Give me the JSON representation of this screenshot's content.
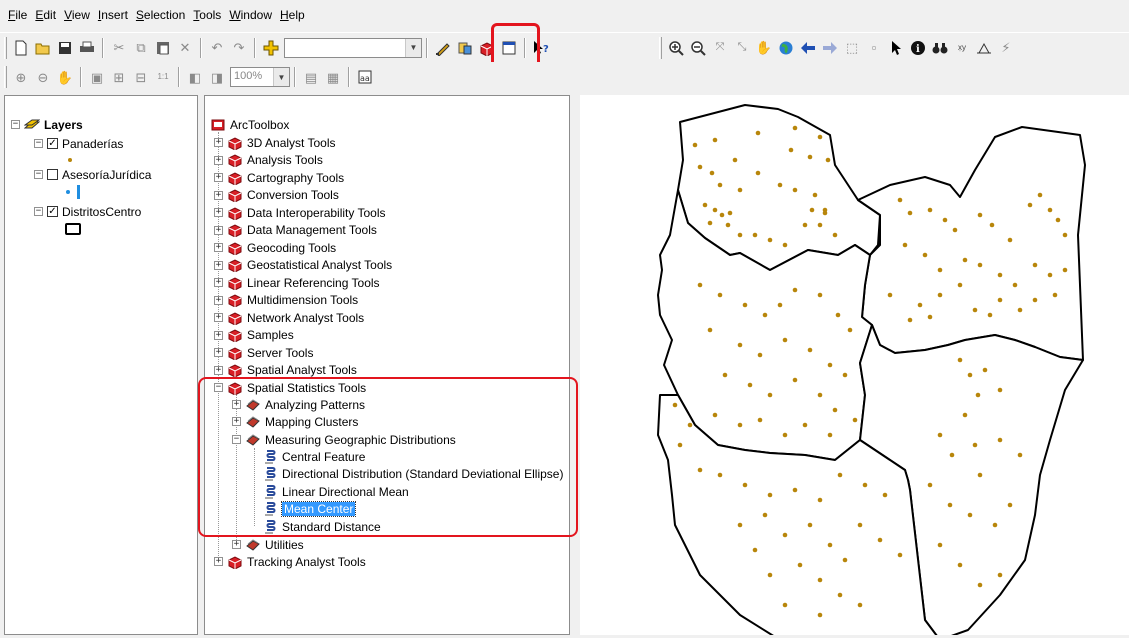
{
  "menu": [
    {
      "u": "F",
      "rest": "ile"
    },
    {
      "u": "E",
      "rest": "dit"
    },
    {
      "u": "V",
      "rest": "iew"
    },
    {
      "u": "I",
      "rest": "nsert"
    },
    {
      "u": "S",
      "rest": "election"
    },
    {
      "u": "T",
      "rest": "ools"
    },
    {
      "u": "W",
      "rest": "indow"
    },
    {
      "u": "H",
      "rest": "elp"
    }
  ],
  "toolbar": {
    "scale_value": "",
    "zoom_value": "100%"
  },
  "toc": {
    "title": "Layers",
    "layers": [
      {
        "name": "Panaderías",
        "checked": true
      },
      {
        "name": "AsesoríaJurídica",
        "checked": false
      },
      {
        "name": "DistritosCentro",
        "checked": true
      }
    ]
  },
  "toolbox": {
    "root": "ArcToolbox",
    "toolsets": [
      "3D Analyst Tools",
      "Analysis Tools",
      "Cartography Tools",
      "Conversion Tools",
      "Data Interoperability Tools",
      "Data Management Tools",
      "Geocoding Tools",
      "Geostatistical Analyst Tools",
      "Linear Referencing Tools",
      "Multidimension Tools",
      "Network Analyst Tools",
      "Samples",
      "Server Tools",
      "Spatial Analyst Tools"
    ],
    "spatial_stats": "Spatial Statistics Tools",
    "sub_toolsets": [
      "Analyzing Patterns",
      "Mapping Clusters",
      "Measuring Geographic Distributions"
    ],
    "tools": [
      "Central Feature",
      "Directional Distribution (Standard Deviational Ellipse)",
      "Linear Directional Mean",
      "Mean Center",
      "Standard Distance"
    ],
    "selected_tool": "Mean Center",
    "utilities": "Utilities",
    "tracking": "Tracking Analyst Tools"
  },
  "colors": {
    "highlight": "#e3151e",
    "selection": "#3399ff",
    "point": "#b8860b"
  }
}
